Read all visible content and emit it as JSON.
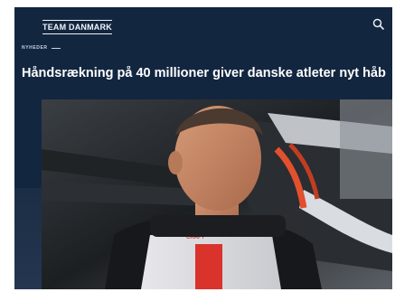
{
  "header": {
    "logo_text": "TEAM DANMARK",
    "search_icon": "search-icon"
  },
  "article": {
    "kicker": "NYHEDER",
    "headline": "Håndsrækning på 40 millioner giver danske atleter nyt håb",
    "photo_brand_text": "CRAFT"
  },
  "colors": {
    "background_navy": "#122640",
    "text_white": "#ffffff"
  }
}
